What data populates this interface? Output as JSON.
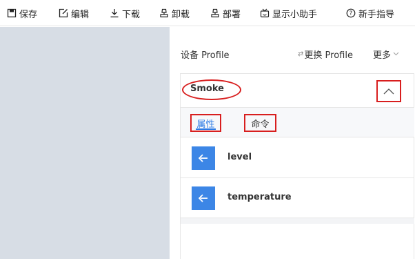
{
  "toolbar": {
    "items": [
      {
        "label": "保存",
        "icon": "save-icon"
      },
      {
        "label": "编辑",
        "icon": "edit-icon"
      },
      {
        "label": "下载",
        "icon": "download-icon"
      },
      {
        "label": "卸载",
        "icon": "unload-icon"
      },
      {
        "label": "部署",
        "icon": "deploy-icon"
      },
      {
        "label": "显示小助手",
        "icon": "assistant-icon"
      },
      {
        "label": "新手指导",
        "icon": "help-icon"
      }
    ]
  },
  "profile_panel": {
    "title": "设备 Profile",
    "change_profile": "更换 Profile",
    "more": "更多"
  },
  "card": {
    "title": "Smoke",
    "tabs": [
      {
        "label": "属性",
        "active": true
      },
      {
        "label": "命令",
        "active": false
      }
    ],
    "items": [
      {
        "label": "level"
      },
      {
        "label": "temperature"
      }
    ]
  },
  "colors": {
    "accent": "#2d7be5",
    "icon_bg": "#3c86e6",
    "highlight": "#d81e1e",
    "left_pane": "#d7dde5"
  }
}
